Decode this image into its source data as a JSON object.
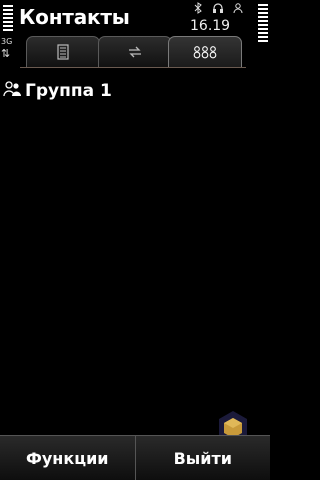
{
  "status": {
    "network": "3G",
    "time": "16.19"
  },
  "app": {
    "title": "Контакты"
  },
  "tabs": [
    {
      "icon": "contact-list-icon",
      "active": false
    },
    {
      "icon": "sync-icon",
      "active": false
    },
    {
      "icon": "groups-icon",
      "active": true
    }
  ],
  "groups": [
    {
      "icon": "group-icon",
      "label": "Группа 1"
    }
  ],
  "softkeys": {
    "left": "Функции",
    "right": "Выйти"
  },
  "colors": {
    "background": "#000000",
    "tab_border_active": "#7a7a7a",
    "tab_underline": "#6a5a50",
    "softkey_border": "#555555"
  }
}
